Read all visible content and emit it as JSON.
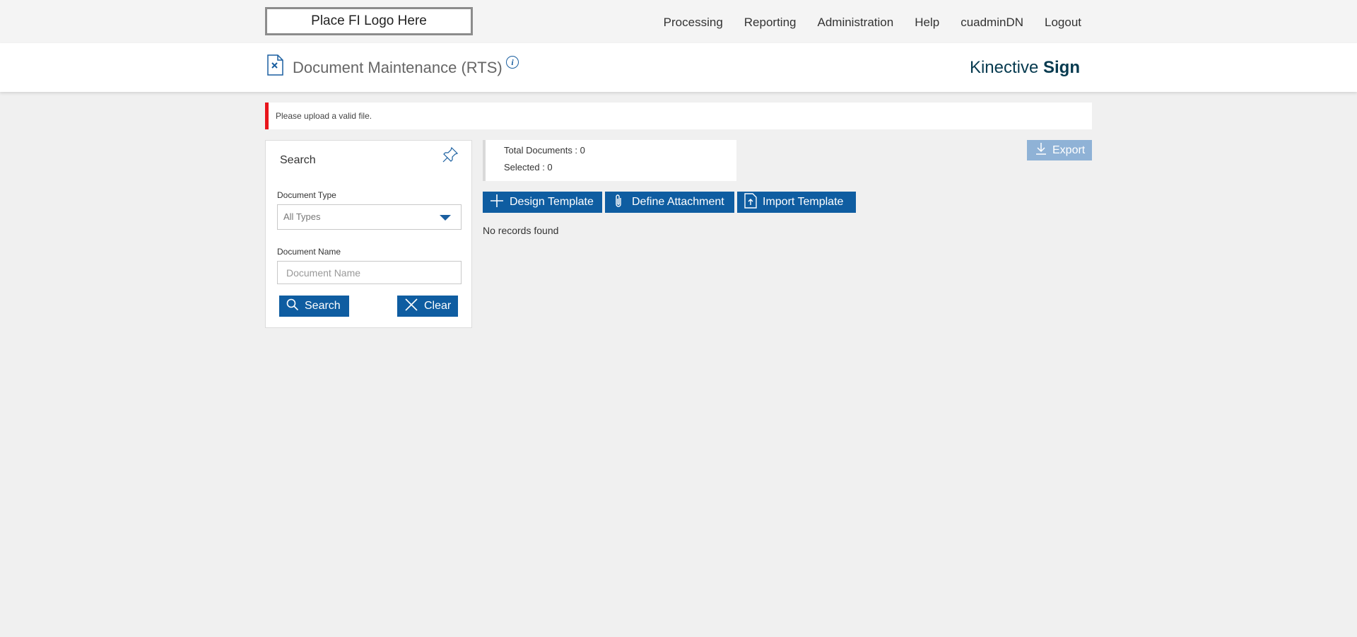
{
  "header": {
    "logo_text": "Place FI Logo Here",
    "nav": [
      "Processing",
      "Reporting",
      "Administration",
      "Help",
      "cuadminDN",
      "Logout"
    ]
  },
  "title_bar": {
    "page_title": "Document Maintenance (RTS)",
    "brand_regular": "Kinective",
    "brand_bold": "Sign"
  },
  "alert": {
    "message": "Please upload a valid file.",
    "accent_color": "#e8141b"
  },
  "search_panel": {
    "title": "Search",
    "document_type_label": "Document Type",
    "document_type_value": "All Types",
    "document_name_label": "Document Name",
    "document_name_placeholder": "Document Name",
    "search_button": "Search",
    "clear_button": "Clear"
  },
  "summary": {
    "total_documents": "Total Documents : 0",
    "selected": "Selected : 0"
  },
  "actions": {
    "export": "Export",
    "design_template": "Design Template",
    "define_attachment": "Define Attachment",
    "import_template": "Import Template"
  },
  "results": {
    "empty_message": "No records found"
  },
  "colors": {
    "primary": "#0f5da1",
    "disabled": "#8fb2d6",
    "brand": "#063a4f"
  }
}
